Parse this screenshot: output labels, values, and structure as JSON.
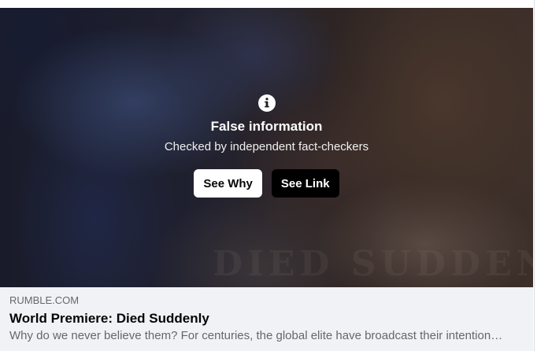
{
  "warning": {
    "icon": "info-icon",
    "title": "False information",
    "subtitle": "Checked by independent fact-checkers",
    "see_why_label": "See Why",
    "see_link_label": "See Link"
  },
  "media": {
    "watermark_text": "DIED SUDDENLY"
  },
  "link_preview": {
    "domain": "RUMBLE.COM",
    "headline": "World Premiere: Died Suddenly",
    "description": "Why do we never believe them? For centuries, the global elite have broadcast their intentions openly…"
  },
  "colors": {
    "preview_background": "#f0f2f5",
    "secondary_text": "#65676b",
    "primary_text": "#050505",
    "dark_button": "#000000",
    "light_button": "#ffffff"
  }
}
